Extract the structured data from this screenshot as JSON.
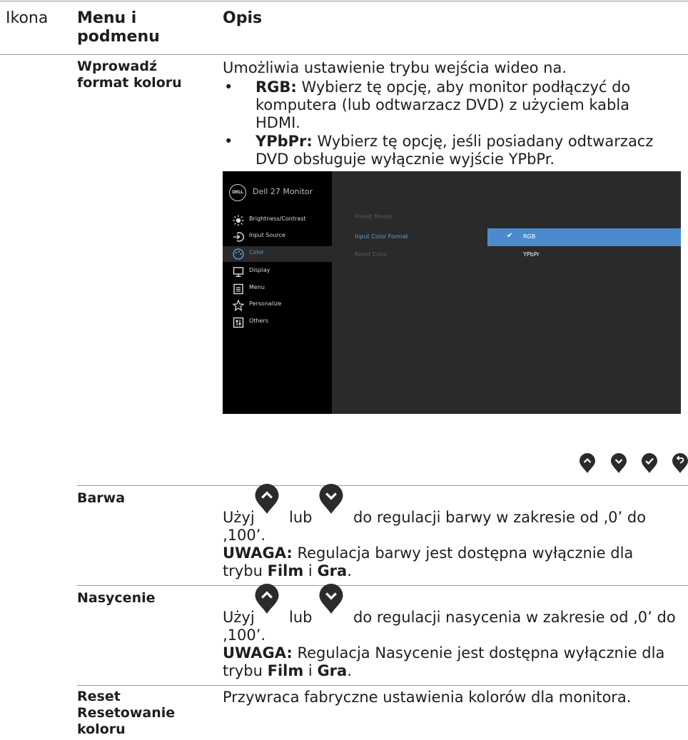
{
  "header": {
    "col_icon": "Ikona",
    "col_menu": "Menu i podmenu",
    "col_desc": "Opis"
  },
  "rows": {
    "input_color_format": {
      "label": "Wprowadź format koloru",
      "intro": "Umożliwia ustawienie trybu wejścia wideo na.",
      "bullets": [
        {
          "term": "RGB:",
          "text": " Wybierz tę opcję, aby monitor podłączyć do komputera (lub odtwarzacz DVD) z użyciem kabla HDMI."
        },
        {
          "term": "YPbPr:",
          "text": " Wybierz tę opcję, jeśli posiadany odtwarzacz DVD obsługuje wyłącznie wyjście YPbPr."
        }
      ]
    },
    "hue": {
      "label": "Barwa",
      "use": "Użyj",
      "or": "lub",
      "range_text": "do regulacji barwy w zakresie od ‚0’ do ‚100’.",
      "note_label": "UWAGA:",
      "note_text": " Regulacja barwy jest dostępna wyłącznie dla trybu ",
      "mode1": "Film",
      "and": " i ",
      "mode2": "Gra",
      "end": "."
    },
    "saturation": {
      "label": "Nasycenie",
      "use": "Użyj",
      "or": "lub",
      "range_text": "do regulacji nasycenia w zakresie od ‚0’ do ‚100’.",
      "note_label": "UWAGA:",
      "note_text": " Regulacja Nasycenie jest dostępna wyłącznie dla trybu ",
      "mode1": "Film",
      "and": " i ",
      "mode2": "Gra",
      "end": "."
    },
    "reset": {
      "label": "Reset Resetowanie koloru",
      "text": "Przywraca fabryczne ustawienia kolorów dla monitora."
    }
  },
  "osd": {
    "logo": "DELL",
    "title": "Dell 27 Monitor",
    "menu": [
      {
        "label": "Brightness/Contrast",
        "icon": "sun-icon"
      },
      {
        "label": "Input Source",
        "icon": "input-source-icon"
      },
      {
        "label": "Color",
        "icon": "palette-icon"
      },
      {
        "label": "Display",
        "icon": "display-icon"
      },
      {
        "label": "Menu",
        "icon": "menu-icon"
      },
      {
        "label": "Personalize",
        "icon": "star-icon"
      },
      {
        "label": "Others",
        "icon": "others-icon"
      }
    ],
    "submenu": [
      "Preset Modes",
      "Input Color Format",
      "Reset Color"
    ],
    "options": [
      "RGB",
      "YPbPr"
    ],
    "selected_menu": "Color",
    "selected_submenu": "Input Color Format",
    "selected_option": "RGB"
  },
  "nav_buttons": [
    "up-button",
    "down-button",
    "check-button",
    "back-button"
  ],
  "colors": {
    "osd_highlight": "#4c8ad0",
    "osd_bg": "#2a2a2a",
    "osd_sidebar": "#000000",
    "rule": "#9a9a9a"
  }
}
